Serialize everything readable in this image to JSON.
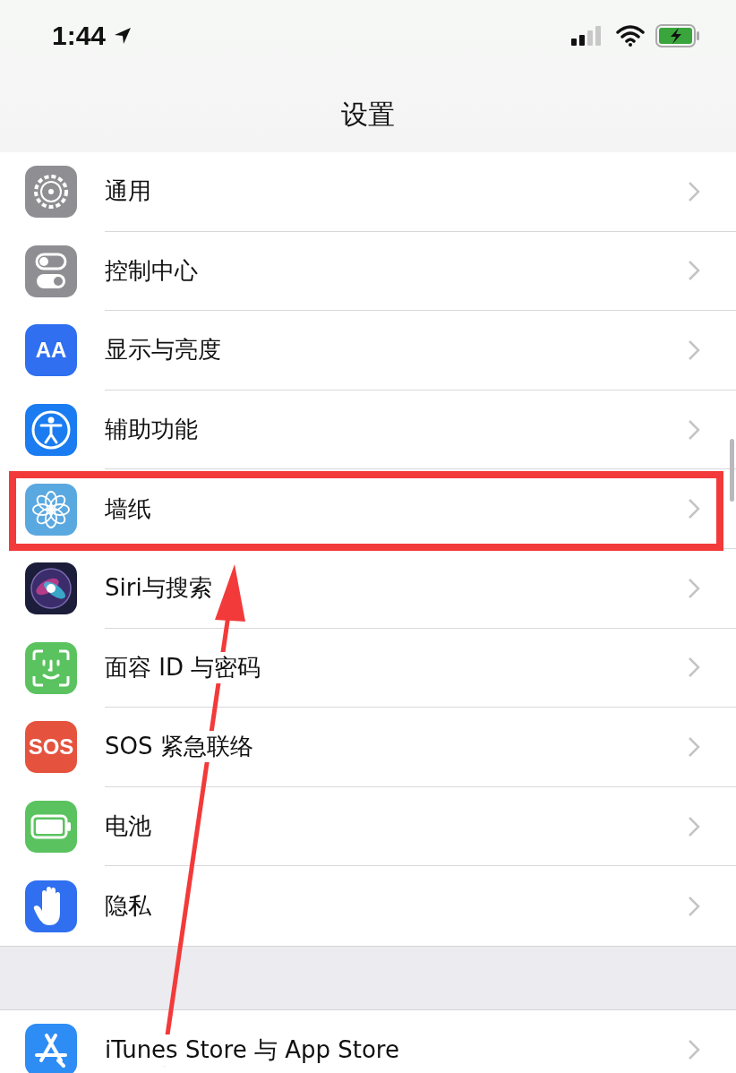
{
  "status_bar": {
    "time": "1:44"
  },
  "nav": {
    "title": "设置"
  },
  "groups": [
    {
      "rows": [
        {
          "kind": "gear",
          "label": "通用",
          "marked": false
        },
        {
          "kind": "toggles",
          "label": "控制中心",
          "marked": false
        },
        {
          "kind": "text",
          "glyph": "AA",
          "label": "显示与亮度",
          "marked": false
        },
        {
          "kind": "accessibility",
          "label": "辅助功能",
          "marked": false
        },
        {
          "kind": "flower",
          "label": "墙纸",
          "marked": true
        },
        {
          "kind": "siri",
          "label": "Siri与搜索",
          "marked": false
        },
        {
          "kind": "face",
          "label": "面容 ID 与密码",
          "marked": false
        },
        {
          "kind": "text",
          "glyph": "SOS",
          "label": "SOS 紧急联络",
          "marked": false
        },
        {
          "kind": "battery",
          "label": "电池",
          "marked": false
        },
        {
          "kind": "hand",
          "label": "隐私",
          "marked": false
        }
      ]
    },
    {
      "rows": [
        {
          "kind": "appstore",
          "label": "iTunes Store 与 App Store",
          "marked": false
        }
      ]
    }
  ]
}
